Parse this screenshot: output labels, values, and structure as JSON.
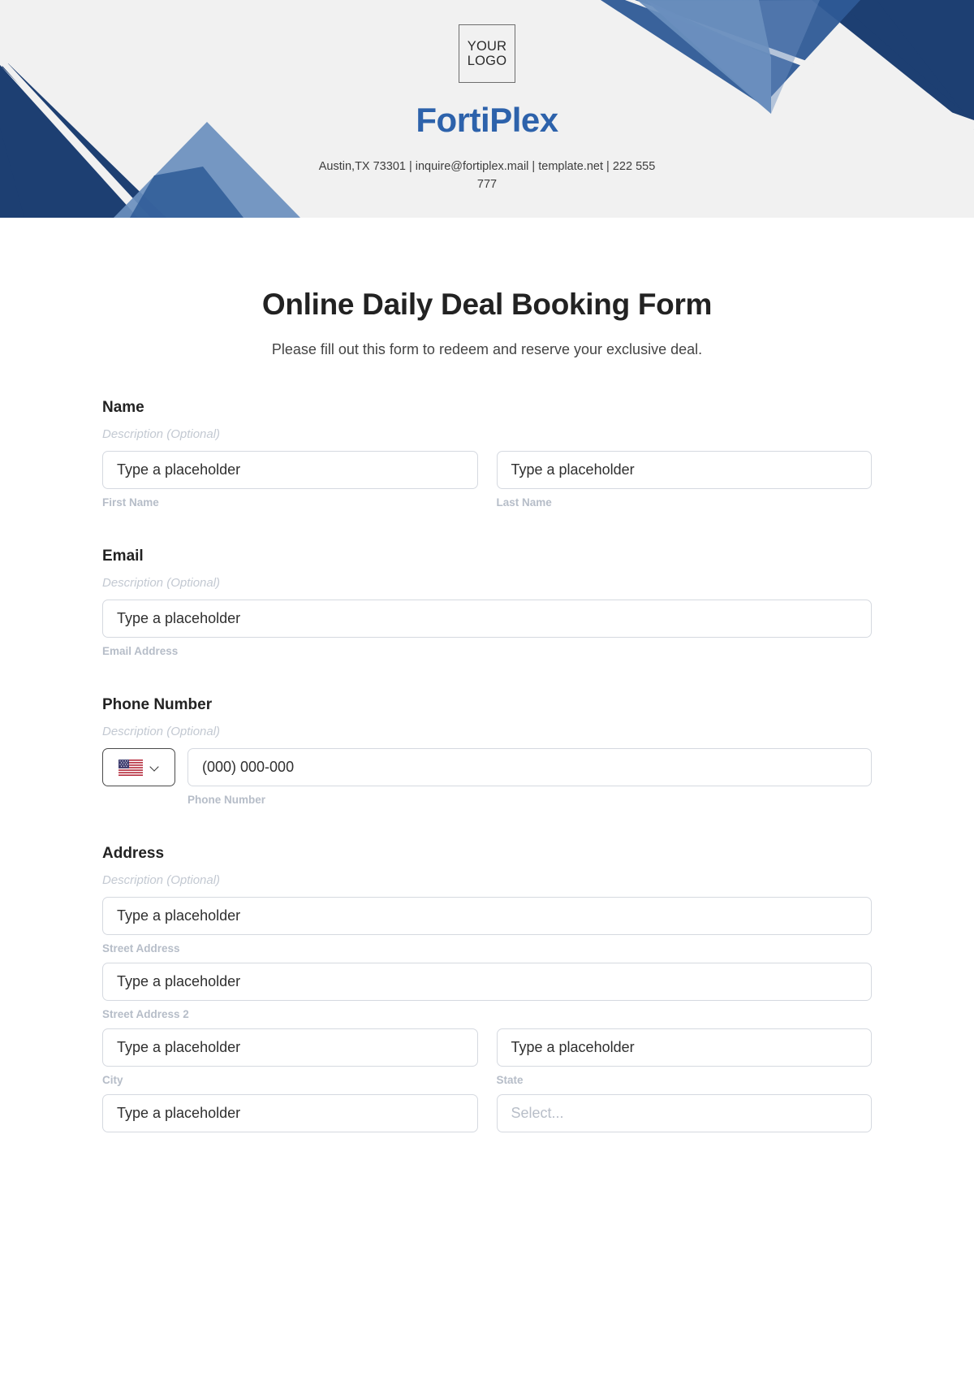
{
  "brand": {
    "logo_line1": "YOUR",
    "logo_line2": "LOGO",
    "name": "FortiPlex",
    "contact": "Austin,TX 73301 | inquire@fortiplex.mail | template.net | 222 555 777",
    "accent_color": "#2d62ab",
    "banner_bg": "#f1f1f1",
    "shape_dark": "#1d3f72",
    "shape_mid": "#2e5a96",
    "shape_light": "#6a8fbe"
  },
  "form": {
    "title": "Online Daily Deal Booking Form",
    "subtitle": "Please fill out this form to redeem and reserve your exclusive deal.",
    "description_optional": "Description (Optional)",
    "placeholder": "Type a placeholder",
    "select_placeholder": "Select...",
    "fields": [
      {
        "label": "Name",
        "description": "Description (Optional)",
        "inputs": [
          {
            "placeholder": "Type a placeholder",
            "sublabel": "First Name"
          },
          {
            "placeholder": "Type a placeholder",
            "sublabel": "Last Name"
          }
        ]
      },
      {
        "label": "Email",
        "description": "Description (Optional)",
        "inputs": [
          {
            "placeholder": "Type a placeholder",
            "sublabel": "Email Address"
          }
        ]
      },
      {
        "label": "Phone Number",
        "description": "Description (Optional)",
        "country_flag": "us-flag-icon",
        "inputs": [
          {
            "placeholder": "(000) 000-000",
            "sublabel": "Phone Number"
          }
        ]
      },
      {
        "label": "Address",
        "description": "Description (Optional)",
        "inputs": [
          {
            "placeholder": "Type a placeholder",
            "sublabel": "Street Address"
          },
          {
            "placeholder": "Type a placeholder",
            "sublabel": "Street Address 2"
          },
          {
            "placeholder": "Type a placeholder",
            "sublabel": "City"
          },
          {
            "placeholder": "Type a placeholder",
            "sublabel": "State"
          },
          {
            "placeholder": "Type a placeholder",
            "sublabel": ""
          },
          {
            "placeholder": "Select...",
            "sublabel": ""
          }
        ]
      }
    ]
  }
}
